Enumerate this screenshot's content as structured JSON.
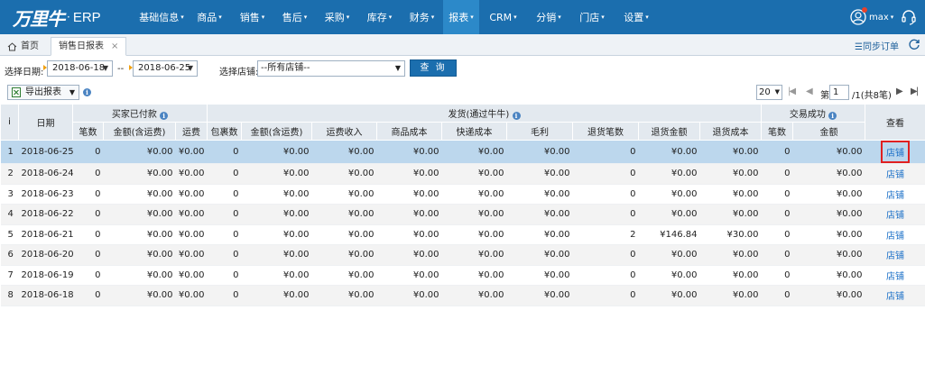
{
  "app": {
    "logo_text": "万里牛",
    "logo_dot": "·",
    "product": "ERP",
    "nav": [
      {
        "label": "基础信息",
        "caret": true
      },
      {
        "label": "商品",
        "caret": true
      },
      {
        "label": "销售",
        "caret": true
      },
      {
        "label": "售后",
        "caret": true
      },
      {
        "label": "采购",
        "caret": true
      },
      {
        "label": "库存",
        "caret": true
      },
      {
        "label": "财务",
        "caret": true
      },
      {
        "label": "报表",
        "caret": true,
        "active": true
      },
      {
        "label": "CRM",
        "caret": true
      },
      {
        "label": "分销",
        "caret": true
      },
      {
        "label": "门店",
        "caret": true
      },
      {
        "label": "设置",
        "caret": true
      }
    ],
    "user": {
      "name": "max",
      "caret": "▾"
    },
    "colors": {
      "nav_bg": "#1b6eae",
      "nav_active": "#2c89c9",
      "link": "#1a6fc7",
      "selected_row": "#bcd7ed",
      "highlight_box": "#e02020"
    }
  },
  "tabs": {
    "home": "首页",
    "active": "销售日报表",
    "close": "×"
  },
  "toolbar_right": {
    "sync": "☰同步订单"
  },
  "filters": {
    "date_label": "选择日期:",
    "date_from": "2018-06-18",
    "date_sep": "--",
    "date_to": "2018-06-25",
    "store_label": "选择店铺:",
    "store_value": "--所有店铺--",
    "query_button": "查 询"
  },
  "actions": {
    "export": "导出报表"
  },
  "pager": {
    "page_size": "20",
    "page_label": "第",
    "page_value": "1",
    "page_suffix": "/1(共8笔)"
  },
  "grid": {
    "group_headers": {
      "index": "i",
      "date": "日期",
      "paid": "买家已付款",
      "shipped": "发货(通过牛牛)",
      "success": "交易成功",
      "view": "查看"
    },
    "columns": [
      "笔数",
      "金额(含运费)",
      "运费",
      "包裹数",
      "金额(含运费)",
      "运费收入",
      "商品成本",
      "快递成本",
      "毛利",
      "退货笔数",
      "退货金额",
      "退货成本",
      "笔数",
      "金额"
    ],
    "rows": [
      {
        "idx": "1",
        "date": "2018-06-25",
        "v": [
          "0",
          "¥0.00",
          "¥0.00",
          "0",
          "¥0.00",
          "¥0.00",
          "¥0.00",
          "¥0.00",
          "¥0.00",
          "0",
          "¥0.00",
          "¥0.00",
          "0",
          "¥0.00"
        ],
        "link": "店铺"
      },
      {
        "idx": "2",
        "date": "2018-06-24",
        "v": [
          "0",
          "¥0.00",
          "¥0.00",
          "0",
          "¥0.00",
          "¥0.00",
          "¥0.00",
          "¥0.00",
          "¥0.00",
          "0",
          "¥0.00",
          "¥0.00",
          "0",
          "¥0.00"
        ],
        "link": "店铺"
      },
      {
        "idx": "3",
        "date": "2018-06-23",
        "v": [
          "0",
          "¥0.00",
          "¥0.00",
          "0",
          "¥0.00",
          "¥0.00",
          "¥0.00",
          "¥0.00",
          "¥0.00",
          "0",
          "¥0.00",
          "¥0.00",
          "0",
          "¥0.00"
        ],
        "link": "店铺"
      },
      {
        "idx": "4",
        "date": "2018-06-22",
        "v": [
          "0",
          "¥0.00",
          "¥0.00",
          "0",
          "¥0.00",
          "¥0.00",
          "¥0.00",
          "¥0.00",
          "¥0.00",
          "0",
          "¥0.00",
          "¥0.00",
          "0",
          "¥0.00"
        ],
        "link": "店铺"
      },
      {
        "idx": "5",
        "date": "2018-06-21",
        "v": [
          "0",
          "¥0.00",
          "¥0.00",
          "0",
          "¥0.00",
          "¥0.00",
          "¥0.00",
          "¥0.00",
          "¥0.00",
          "2",
          "¥146.84",
          "¥30.00",
          "0",
          "¥0.00"
        ],
        "link": "店铺"
      },
      {
        "idx": "6",
        "date": "2018-06-20",
        "v": [
          "0",
          "¥0.00",
          "¥0.00",
          "0",
          "¥0.00",
          "¥0.00",
          "¥0.00",
          "¥0.00",
          "¥0.00",
          "0",
          "¥0.00",
          "¥0.00",
          "0",
          "¥0.00"
        ],
        "link": "店铺"
      },
      {
        "idx": "7",
        "date": "2018-06-19",
        "v": [
          "0",
          "¥0.00",
          "¥0.00",
          "0",
          "¥0.00",
          "¥0.00",
          "¥0.00",
          "¥0.00",
          "¥0.00",
          "0",
          "¥0.00",
          "¥0.00",
          "0",
          "¥0.00"
        ],
        "link": "店铺"
      },
      {
        "idx": "8",
        "date": "2018-06-18",
        "v": [
          "0",
          "¥0.00",
          "¥0.00",
          "0",
          "¥0.00",
          "¥0.00",
          "¥0.00",
          "¥0.00",
          "¥0.00",
          "0",
          "¥0.00",
          "¥0.00",
          "0",
          "¥0.00"
        ],
        "link": "店铺"
      }
    ]
  }
}
